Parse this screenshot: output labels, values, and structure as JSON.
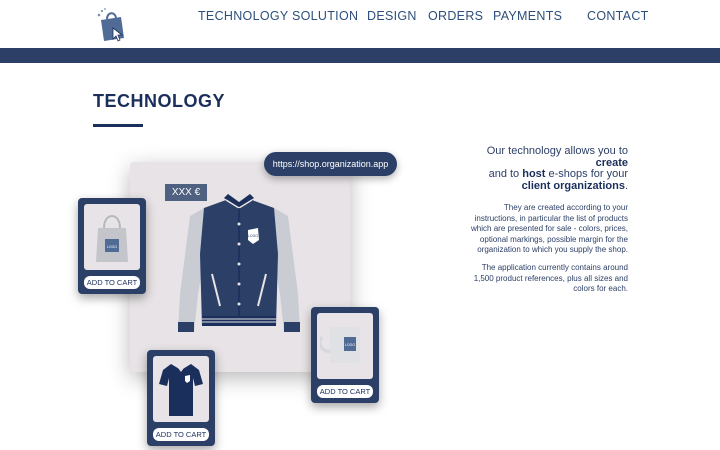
{
  "nav": {
    "logo_icon": "shopping-bag-cursor-icon",
    "items": [
      {
        "label": "TECHNOLOGY"
      },
      {
        "label": "SOLUTION"
      },
      {
        "label": "DESIGN"
      },
      {
        "label": "ORDERS"
      },
      {
        "label": "PAYMENTS"
      },
      {
        "label": "CONTACT"
      }
    ]
  },
  "colors": {
    "brand_navy": "#2c3f66",
    "title_navy": "#1b2f5c",
    "showcase_bg": "#e7e3e6"
  },
  "section": {
    "title": "TECHNOLOGY"
  },
  "showcase": {
    "url": "https://shop.organization.app",
    "price": "XXX €",
    "logo_text": "LOGO",
    "products": [
      {
        "name": "tote-bag",
        "button": "ADD TO CART"
      },
      {
        "name": "mug",
        "button": "ADD TO CART"
      },
      {
        "name": "polo-shirt",
        "button": "ADD TO CART"
      }
    ]
  },
  "content": {
    "intro": {
      "l1": "Our technology allows you to",
      "l2": "create",
      "l3a": "and to ",
      "l3b": "host",
      "l3c": " e-shops for your",
      "l4": "client organizations",
      "l4_end": "."
    },
    "paragraph1": [
      "They are created according to your",
      "instructions, in particular the list of products",
      "which are presented for sale - colors, prices,",
      "optional markings, possible margin for the",
      "organization to which you supply the shop."
    ],
    "paragraph2": [
      "The application currently contains around",
      "1,500 product references, plus all sizes and",
      "colors for each."
    ]
  }
}
